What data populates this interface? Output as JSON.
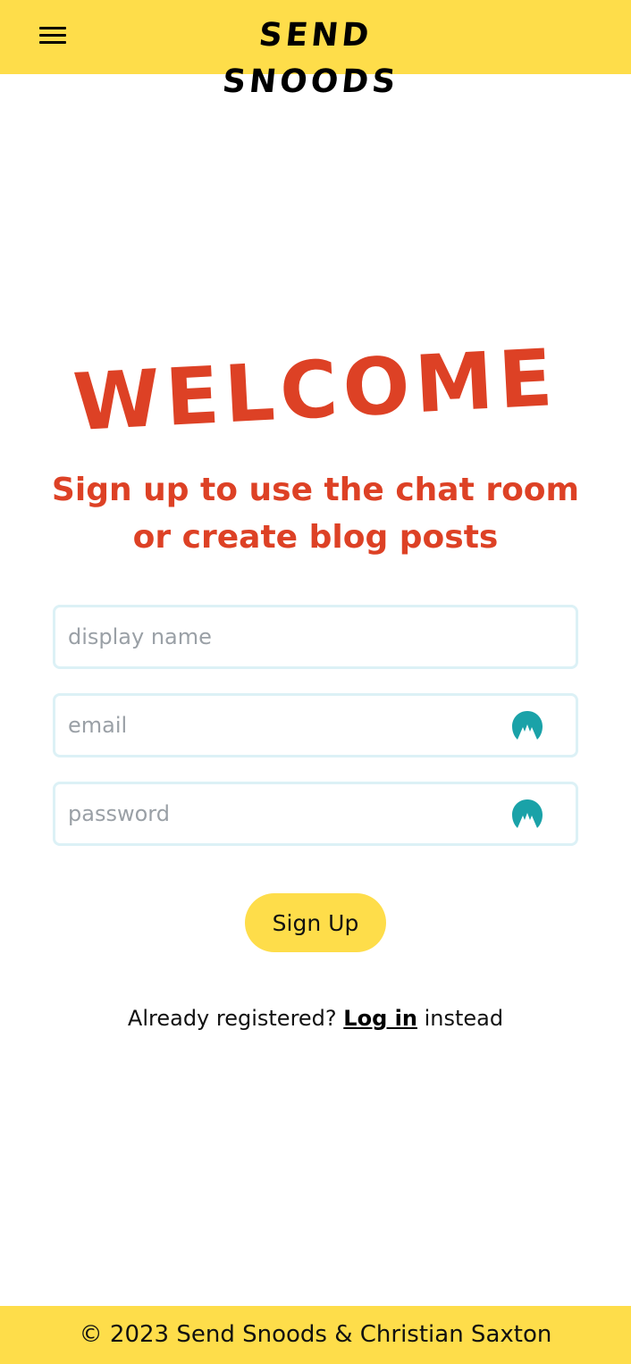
{
  "header": {
    "brand": "Send Snoods",
    "menu_icon": "hamburger-menu-icon"
  },
  "main": {
    "heading": "Welcome",
    "subtitle": "Sign up to use the chat room or create blog posts",
    "fields": {
      "display_name": {
        "placeholder": "display name",
        "value": ""
      },
      "email": {
        "placeholder": "email",
        "value": "",
        "icon": "nordpass-autofill-icon"
      },
      "password": {
        "placeholder": "password",
        "value": "",
        "icon": "nordpass-autofill-icon"
      }
    },
    "signup_label": "Sign Up",
    "login_prompt": {
      "before": "Already registered?",
      "link": "Log in",
      "after": "instead"
    }
  },
  "footer": {
    "text": "© 2023 Send Snoods & Christian Saxton"
  },
  "colors": {
    "brand_yellow": "#fedd4a",
    "accent_red": "#dd4125",
    "field_border": "#dcf1f6",
    "autofill_teal": "#1aa2a8"
  }
}
